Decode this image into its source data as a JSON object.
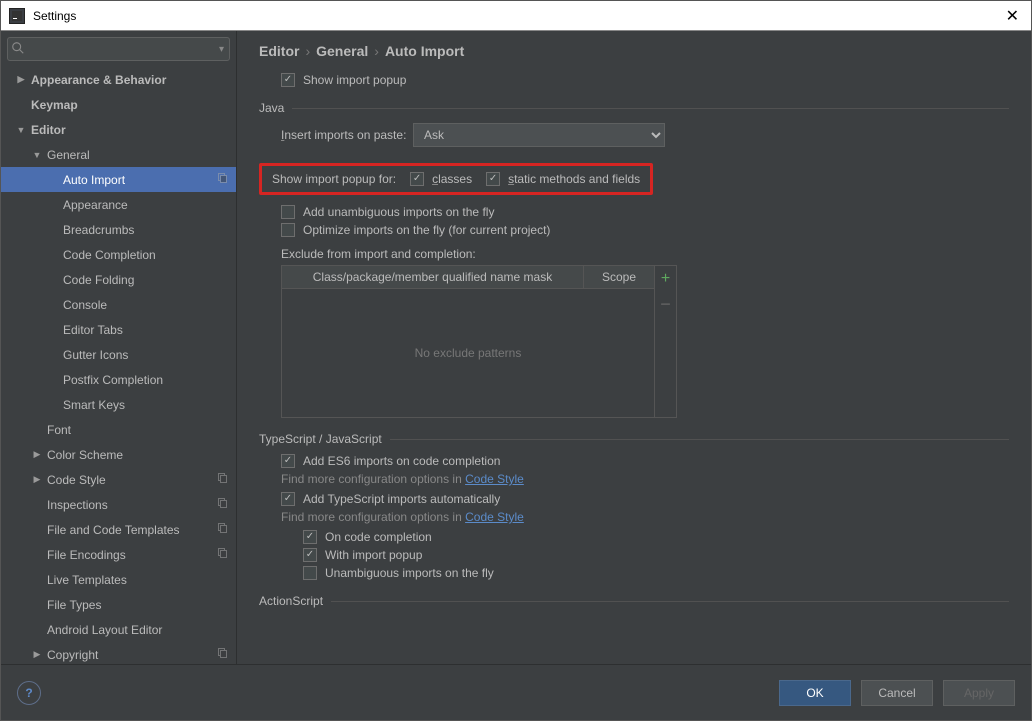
{
  "window": {
    "title": "Settings"
  },
  "sidebar": {
    "search_placeholder": "",
    "items": [
      {
        "label": "Appearance & Behavior",
        "depth": 0,
        "arrow": "▶",
        "bold": true
      },
      {
        "label": "Keymap",
        "depth": 0,
        "arrow": "",
        "bold": true
      },
      {
        "label": "Editor",
        "depth": 0,
        "arrow": "▼",
        "bold": true
      },
      {
        "label": "General",
        "depth": 1,
        "arrow": "▼",
        "bold": false
      },
      {
        "label": "Auto Import",
        "depth": 2,
        "arrow": "",
        "bold": false,
        "selected": true,
        "copy": true
      },
      {
        "label": "Appearance",
        "depth": 2,
        "arrow": "",
        "bold": false
      },
      {
        "label": "Breadcrumbs",
        "depth": 2,
        "arrow": "",
        "bold": false
      },
      {
        "label": "Code Completion",
        "depth": 2,
        "arrow": "",
        "bold": false
      },
      {
        "label": "Code Folding",
        "depth": 2,
        "arrow": "",
        "bold": false
      },
      {
        "label": "Console",
        "depth": 2,
        "arrow": "",
        "bold": false
      },
      {
        "label": "Editor Tabs",
        "depth": 2,
        "arrow": "",
        "bold": false
      },
      {
        "label": "Gutter Icons",
        "depth": 2,
        "arrow": "",
        "bold": false
      },
      {
        "label": "Postfix Completion",
        "depth": 2,
        "arrow": "",
        "bold": false
      },
      {
        "label": "Smart Keys",
        "depth": 2,
        "arrow": "",
        "bold": false
      },
      {
        "label": "Font",
        "depth": 1,
        "arrow": "",
        "bold": false
      },
      {
        "label": "Color Scheme",
        "depth": 1,
        "arrow": "▶",
        "bold": false
      },
      {
        "label": "Code Style",
        "depth": 1,
        "arrow": "▶",
        "bold": false,
        "copy": true
      },
      {
        "label": "Inspections",
        "depth": 1,
        "arrow": "",
        "bold": false,
        "copy": true
      },
      {
        "label": "File and Code Templates",
        "depth": 1,
        "arrow": "",
        "bold": false,
        "copy": true
      },
      {
        "label": "File Encodings",
        "depth": 1,
        "arrow": "",
        "bold": false,
        "copy": true
      },
      {
        "label": "Live Templates",
        "depth": 1,
        "arrow": "",
        "bold": false
      },
      {
        "label": "File Types",
        "depth": 1,
        "arrow": "",
        "bold": false
      },
      {
        "label": "Android Layout Editor",
        "depth": 1,
        "arrow": "",
        "bold": false
      },
      {
        "label": "Copyright",
        "depth": 1,
        "arrow": "▶",
        "bold": false,
        "copy": true
      }
    ]
  },
  "breadcrumb": {
    "a": "Editor",
    "b": "General",
    "c": "Auto Import"
  },
  "general": {
    "show_import_popup": "Show import popup"
  },
  "java": {
    "title": "Java",
    "insert_label": "Insert imports on paste:",
    "insert_value": "Ask",
    "popup_for": "Show import popup for:",
    "classes": "classes",
    "statics": "static methods and fields",
    "unambiguous": "Add unambiguous imports on the fly",
    "optimize": "Optimize imports on the fly (for current project)",
    "exclude_label": "Exclude from import and completion:",
    "th1": "Class/package/member qualified name mask",
    "th2": "Scope",
    "empty": "No exclude patterns"
  },
  "ts": {
    "title": "TypeScript / JavaScript",
    "es6": "Add ES6 imports on code completion",
    "hint_prefix": "Find more configuration options in ",
    "code_style": "Code Style",
    "auto_ts": "Add TypeScript imports automatically",
    "on_completion": "On code completion",
    "with_popup": "With import popup",
    "unambiguous": "Unambiguous imports on the fly"
  },
  "as": {
    "title": "ActionScript"
  },
  "footer": {
    "ok": "OK",
    "cancel": "Cancel",
    "apply": "Apply"
  }
}
